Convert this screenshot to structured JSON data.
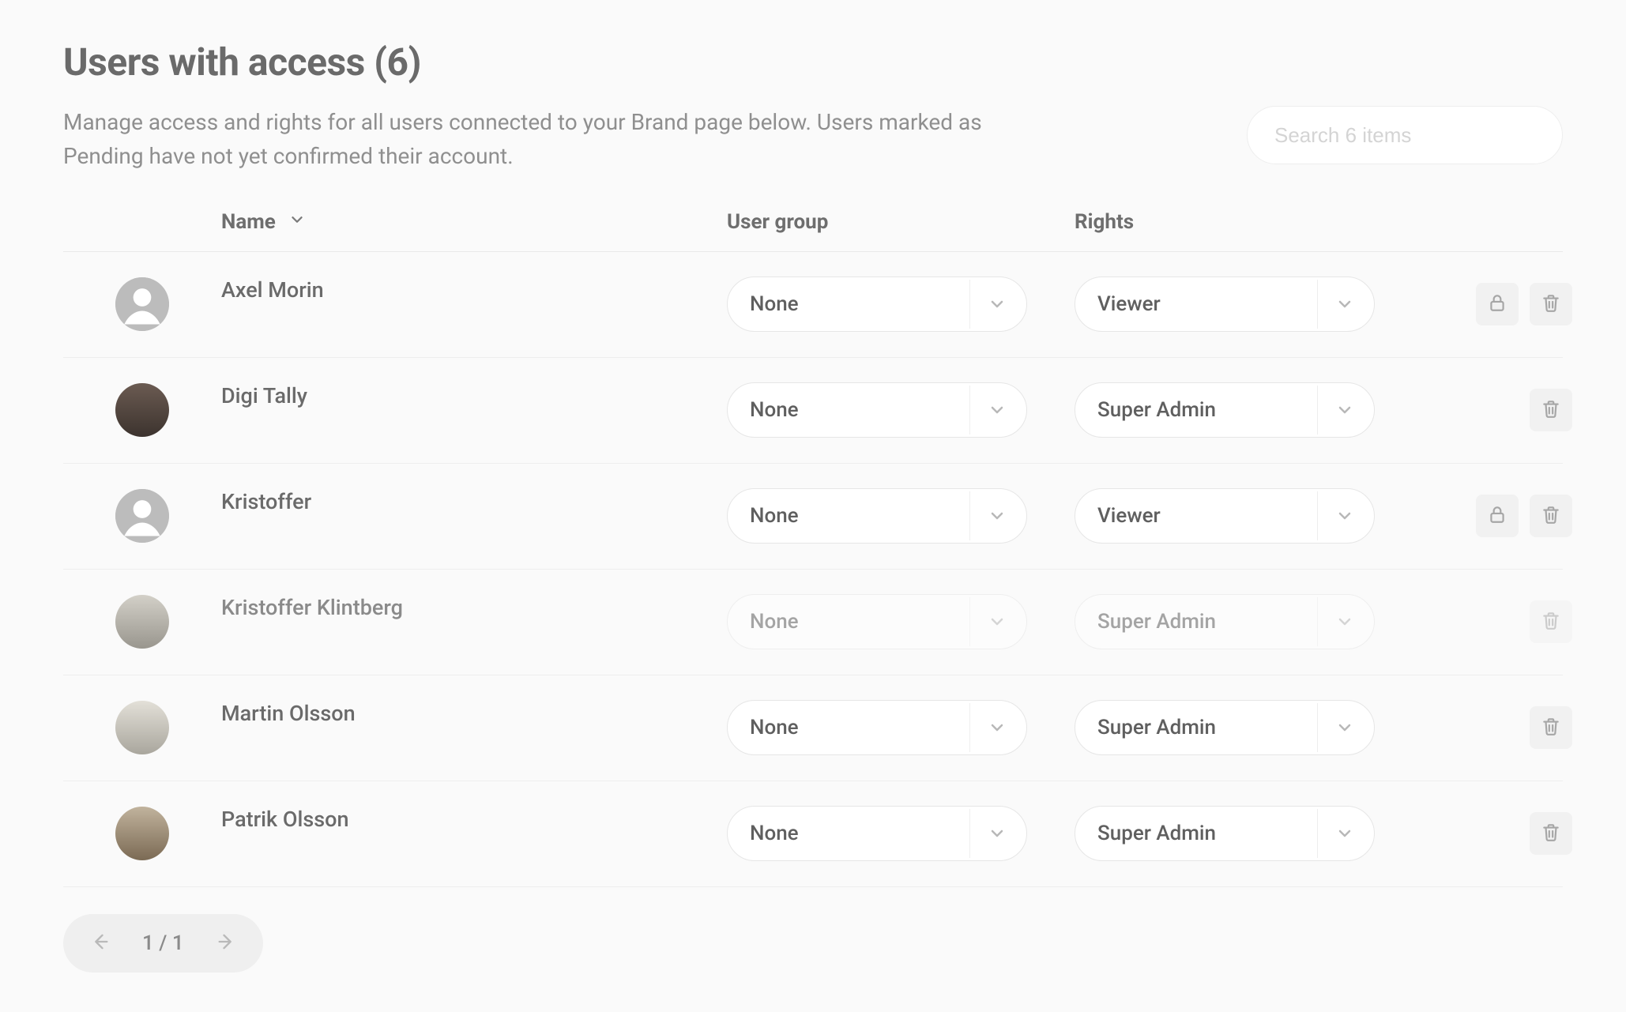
{
  "header": {
    "title": "Users with access (6)",
    "subtitle": "Manage access and rights for all users connected to your Brand page below. Users marked as Pending have not yet confirmed their account."
  },
  "search": {
    "placeholder": "Search 6 items",
    "value": ""
  },
  "table": {
    "columns": {
      "name": "Name",
      "user_group": "User group",
      "rights": "Rights"
    },
    "rows": [
      {
        "name": "Axel Morin",
        "user_group": "None",
        "rights": "Viewer",
        "avatar": "default",
        "has_lock": true,
        "disabled": false
      },
      {
        "name": "Digi Tally",
        "user_group": "None",
        "rights": "Super Admin",
        "avatar": "photo0",
        "has_lock": false,
        "disabled": false
      },
      {
        "name": "Kristoffer",
        "user_group": "None",
        "rights": "Viewer",
        "avatar": "default",
        "has_lock": true,
        "disabled": false
      },
      {
        "name": "Kristoffer Klintberg",
        "user_group": "None",
        "rights": "Super Admin",
        "avatar": "photo1",
        "has_lock": false,
        "disabled": true
      },
      {
        "name": "Martin Olsson",
        "user_group": "None",
        "rights": "Super Admin",
        "avatar": "photo2",
        "has_lock": false,
        "disabled": false
      },
      {
        "name": "Patrik Olsson",
        "user_group": "None",
        "rights": "Super Admin",
        "avatar": "photo3",
        "has_lock": false,
        "disabled": false
      }
    ]
  },
  "pagination": {
    "text": "1 / 1"
  },
  "icons": {
    "chevron_down": "chevron-down-icon",
    "lock": "lock-icon",
    "trash": "trash-icon",
    "arrow_left": "arrow-left-icon",
    "arrow_right": "arrow-right-icon",
    "default_avatar": "person-circle-icon"
  }
}
